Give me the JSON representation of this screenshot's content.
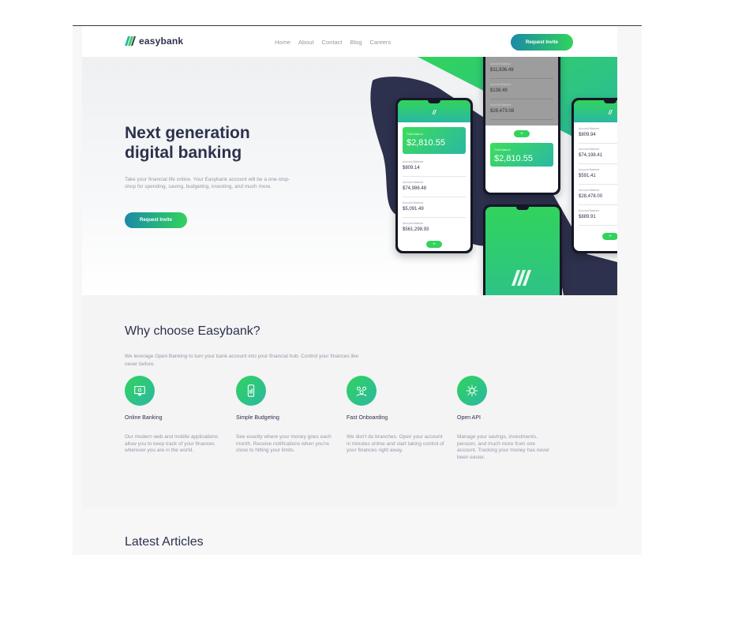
{
  "header": {
    "brand": "easybank",
    "nav": [
      "Home",
      "About",
      "Contact",
      "Blog",
      "Careers"
    ],
    "cta_label": "Request Invite"
  },
  "hero": {
    "title_line1": "Next generation",
    "title_line2": "digital banking",
    "text": "Take your financial life online. Your Easybank account will be a one-stop-shop for spending, saving, budgeting, investing, and much more.",
    "cta_label": "Request Invite"
  },
  "phones": {
    "left": {
      "balance": "$2,810.55",
      "rows": [
        "$809.14",
        "$74,986.48",
        "$5,091.49",
        "$561,298.93"
      ]
    },
    "top": {
      "rows": [
        "$11,836.49",
        "$138.49",
        "$28,473.08"
      ],
      "balance": "$2,810.55"
    },
    "right": {
      "rows": [
        "$809.94",
        "$74,198.41",
        "$591.41",
        "$28,478.00",
        "$889.91"
      ]
    }
  },
  "why": {
    "title": "Why choose Easybank?",
    "intro": "We leverage Open Banking to turn your bank account into your financial hub. Control your finances like never before.",
    "features": [
      {
        "title": "Online Banking",
        "text": "Our modern web and mobile applications allow you to keep track of your finances wherever you are in the world.",
        "icon": "online-banking-icon"
      },
      {
        "title": "Simple Budgeting",
        "text": "See exactly where your money goes each month. Receive notifications when you're close to hitting your limits.",
        "icon": "budgeting-icon"
      },
      {
        "title": "Fast Onboarding",
        "text": "We don't do branches. Open your account in minutes online and start taking control of your finances right away.",
        "icon": "onboarding-icon"
      },
      {
        "title": "Open API",
        "text": "Manage your savings, investments, pension, and much more from one account. Tracking your money has never been easier.",
        "icon": "api-icon"
      }
    ]
  },
  "articles": {
    "title": "Latest Articles"
  },
  "colors": {
    "brand_green": "#31d35c",
    "brand_cyan": "#2bb8a3",
    "dark_blue": "#2d314d",
    "grayish_blue": "#9698a6"
  }
}
